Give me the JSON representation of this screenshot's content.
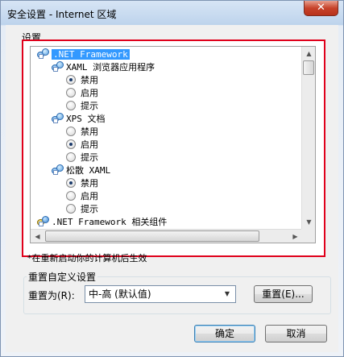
{
  "window": {
    "title": "安全设置 - Internet 区域",
    "close_glyph": "✕"
  },
  "settings_label": "设置",
  "tree": [
    {
      "type": "folder",
      "label": ".NET Framework",
      "selected": true
    },
    {
      "type": "folder",
      "label": "XAML 浏览器应用程序"
    },
    {
      "type": "radio",
      "label": "禁用",
      "checked": true
    },
    {
      "type": "radio",
      "label": "启用",
      "checked": false
    },
    {
      "type": "radio",
      "label": "提示",
      "checked": false
    },
    {
      "type": "folder",
      "label": "XPS 文档"
    },
    {
      "type": "radio",
      "label": "禁用",
      "checked": false
    },
    {
      "type": "radio",
      "label": "启用",
      "checked": true
    },
    {
      "type": "radio",
      "label": "提示",
      "checked": false
    },
    {
      "type": "folder",
      "label": "松散 XAML"
    },
    {
      "type": "radio",
      "label": "禁用",
      "checked": true
    },
    {
      "type": "radio",
      "label": "启用",
      "checked": false
    },
    {
      "type": "radio",
      "label": "提示",
      "checked": false
    },
    {
      "type": "folder-yellow",
      "label": ".NET Framework 相关组件"
    }
  ],
  "note": "*在重新启动你的计算机后生效",
  "reset": {
    "group_label": "重置自定义设置",
    "reset_to_label": "重置为(R):",
    "selected_level": "中-高 (默认值)",
    "reset_button": "重置(E)..."
  },
  "buttons": {
    "ok": "确定",
    "cancel": "取消"
  },
  "colors": {
    "highlight_border": "#e0001b",
    "selection": "#3399ff"
  }
}
